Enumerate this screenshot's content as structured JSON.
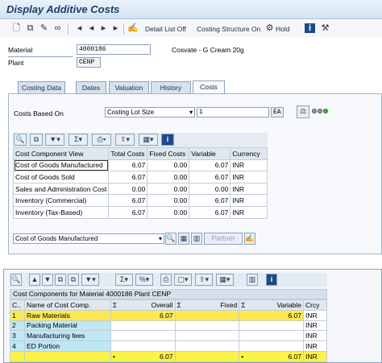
{
  "window_title": "Display Additive Costs",
  "toolbar": {
    "detail_list_label": "Detail List Off",
    "costing_structure_label": "Costing Structure On",
    "hold_label": "Hold"
  },
  "header": {
    "material_label": "Material",
    "material_value": "4000186",
    "material_desc": "Cosvate - G Cream 20g",
    "plant_label": "Plant",
    "plant_value": "CENP"
  },
  "tabs": [
    "Costing Data",
    "Dates",
    "Valuation",
    "History",
    "Costs"
  ],
  "costs_panel": {
    "costs_based_on_label": "Costs Based On",
    "costs_based_on_value": "Costing Lot Size",
    "lot_size": "1",
    "uom": "EA",
    "view_dropdown_value": "Cost of Goods Manufactured",
    "partner_label": "Partner"
  },
  "cost_component_table": {
    "headers": [
      "Cost Component View",
      "Total Costs",
      "Fixed Costs",
      "Variable",
      "Currency"
    ],
    "rows": [
      [
        "Cost of Goods Manufactured",
        "6.07",
        "0.00",
        "6.07",
        "INR"
      ],
      [
        "Cost of Goods Sold",
        "6.07",
        "0.00",
        "6.07",
        "INR"
      ],
      [
        "Sales and Administration Cost",
        "0.00",
        "0.00",
        "0.00",
        "INR"
      ],
      [
        "Inventory (Commercial)",
        "6.07",
        "0.00",
        "6.07",
        "INR"
      ],
      [
        "Inventory (Tax-Based)",
        "6.07",
        "0.00",
        "6.07",
        "INR"
      ]
    ]
  },
  "components_grid": {
    "caption": "Cost Components for Material 4000186 Plant CENP",
    "headers": [
      "C..",
      "Name of Cost Comp.",
      "Overall",
      "Fixed",
      "Variable",
      "Crcy"
    ],
    "sigma": "Σ",
    "rows": [
      [
        "1",
        "Raw Materials",
        "6.07",
        "",
        "6.07",
        "INR"
      ],
      [
        "2",
        "Packing Material",
        "",
        "",
        "",
        "INR"
      ],
      [
        "3",
        "Manufacturing fees",
        "",
        "",
        "",
        "INR"
      ],
      [
        "4",
        "ED Portion",
        "",
        "",
        "",
        "INR"
      ]
    ],
    "total": {
      "marker": "•",
      "overall": "6.07",
      "variable": "6.07",
      "currency": "INR"
    }
  }
}
